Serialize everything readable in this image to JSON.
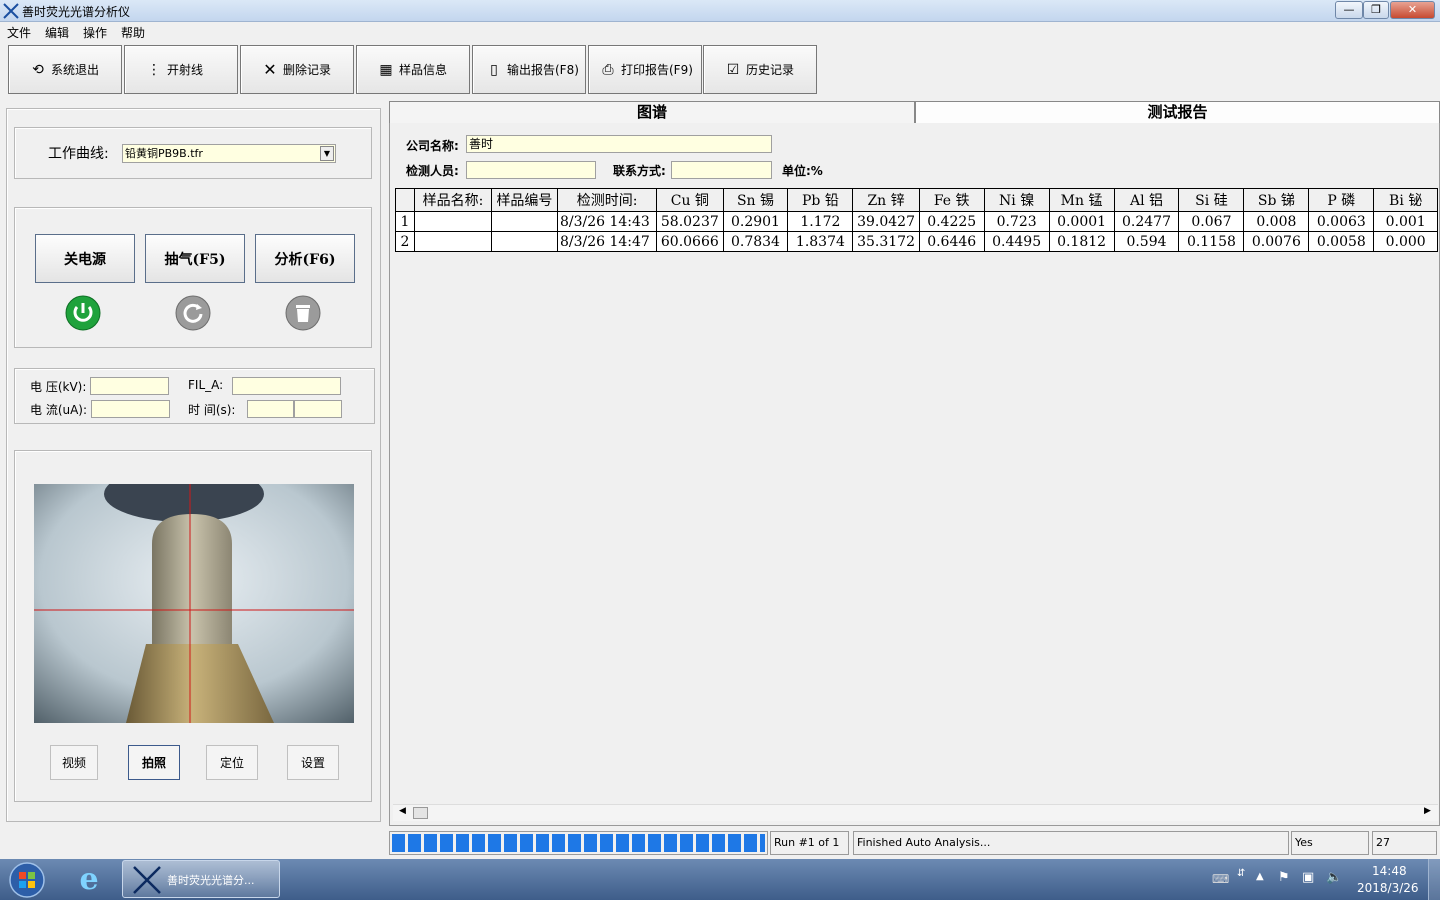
{
  "window": {
    "title": "善时荧光光谱分析仪",
    "controls": [
      "—",
      "❐",
      "✕"
    ]
  },
  "menu": [
    "文件",
    "编辑",
    "操作",
    "帮助"
  ],
  "toolbar": [
    {
      "label": "系统退出",
      "icon": "exit-icon"
    },
    {
      "label": "开射线",
      "icon": "xray-icon"
    },
    {
      "label": "删除记录",
      "icon": "delete-icon"
    },
    {
      "label": "样品信息",
      "icon": "sample-info-icon"
    },
    {
      "label": "输出报告(F8)",
      "icon": "document-icon"
    },
    {
      "label": "打印报告(F9)",
      "icon": "printer-icon"
    },
    {
      "label": "历史记录",
      "icon": "history-icon"
    }
  ],
  "curve": {
    "label": "工作曲线:",
    "value": "铅黄铜PB9B.tfr"
  },
  "actions": {
    "power": "关电源",
    "pump": "抽气(F5)",
    "analyze": "分析(F6)"
  },
  "params": {
    "voltage_label": "电  压(kV):",
    "current_label": "电  流(uA):",
    "fil_label": "FIL_A:",
    "time_label": "时  间(s):"
  },
  "camera": {
    "buttons": [
      "视频",
      "拍照",
      "定位",
      "设置"
    ],
    "active": "拍照"
  },
  "tabs": {
    "spectrum": "图谱",
    "report": "测试报告"
  },
  "report": {
    "company_label": "公司名称:",
    "company_value": "善时",
    "inspector_label": "检测人员:",
    "contact_label": "联系方式:",
    "unit_label": "单位:%"
  },
  "table": {
    "headers": [
      "",
      "样品名称:",
      "样品编号",
      "检测时间:",
      "Cu 铜",
      "Sn 锡",
      "Pb 铅",
      "Zn 锌",
      "Fe 铁",
      "Ni 镍",
      "Mn 锰",
      "Al 铝",
      "Si 硅",
      "Sb 锑",
      "P 磷",
      "Bi 铋"
    ],
    "rows": [
      [
        "1",
        "",
        "",
        "8/3/26 14:43",
        "58.0237",
        "0.2901",
        "1.172",
        "39.0427",
        "0.4225",
        "0.723",
        "0.0001",
        "0.2477",
        "0.067",
        "0.008",
        "0.0063",
        "0.001"
      ],
      [
        "2",
        "",
        "",
        "8/3/26 14:47",
        "60.0666",
        "0.7834",
        "1.8374",
        "35.3172",
        "0.6446",
        "0.4495",
        "0.1812",
        "0.594",
        "0.1158",
        "0.0076",
        "0.0058",
        "0.000"
      ]
    ]
  },
  "status": {
    "progress": 1.0,
    "run": "Run #1 of 1",
    "message": "Finished Auto Analysis...",
    "flag": "Yes",
    "count": "27"
  },
  "taskbar": {
    "app_label": "善时荧光光谱分...",
    "time": "14:48",
    "date": "2018/3/26"
  },
  "colors": {
    "progress": "#1e78e6",
    "input_bg": "#ffffe1",
    "power_icon": "#1fa23c"
  }
}
